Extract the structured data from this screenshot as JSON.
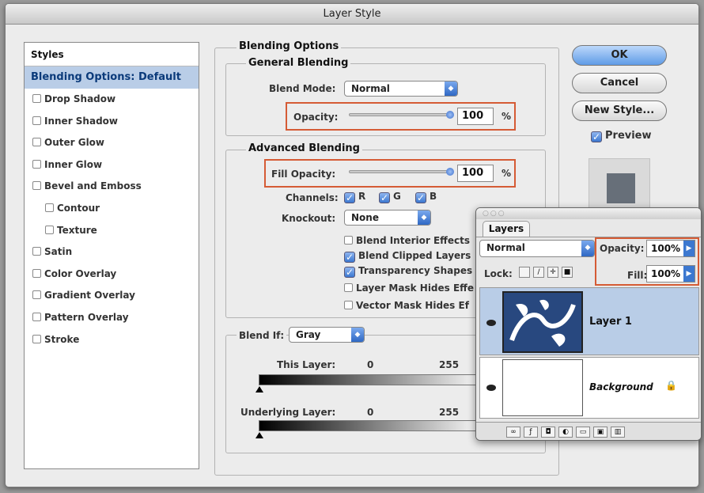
{
  "window": {
    "title": "Layer Style"
  },
  "styles_panel": {
    "header": "Styles",
    "selected": "Blending Options: Default",
    "items": [
      "Drop Shadow",
      "Inner Shadow",
      "Outer Glow",
      "Inner Glow",
      "Bevel and Emboss",
      "Contour",
      "Texture",
      "Satin",
      "Color Overlay",
      "Gradient Overlay",
      "Pattern Overlay",
      "Stroke"
    ]
  },
  "blending": {
    "section_title": "Blending Options",
    "general_title": "General Blending",
    "blend_mode_label": "Blend Mode:",
    "blend_mode_value": "Normal",
    "opacity_label": "Opacity:",
    "opacity_value": "100",
    "opacity_unit": "%",
    "opacity_level": 1.0,
    "advanced_title": "Advanced Blending",
    "fill_opacity_label": "Fill Opacity:",
    "fill_opacity_value": "100",
    "fill_opacity_unit": "%",
    "fill_opacity_level": 1.0,
    "channels_label": "Channels:",
    "channels": [
      "R",
      "G",
      "B"
    ],
    "knockout_label": "Knockout:",
    "knockout_value": "None",
    "options": [
      {
        "label": "Blend Interior Effects",
        "checked": false
      },
      {
        "label": "Blend Clipped Layers",
        "checked": true
      },
      {
        "label": "Transparency Shapes",
        "checked": true
      },
      {
        "label": "Layer Mask Hides Effe",
        "checked": false
      },
      {
        "label": "Vector Mask Hides Ef",
        "checked": false
      }
    ],
    "blend_if_label": "Blend If:",
    "blend_if_value": "Gray",
    "this_layer_label": "This Layer:",
    "this_layer_min": "0",
    "this_layer_max": "255",
    "underlying_label": "Underlying Layer:",
    "underlying_min": "0",
    "underlying_max": "255"
  },
  "buttons": {
    "ok": "OK",
    "cancel": "Cancel",
    "new_style": "New Style...",
    "preview": "Preview"
  },
  "layers_palette": {
    "title_dots": "○○○",
    "tab": "Layers",
    "mode": "Normal",
    "opacity_label": "Opacity:",
    "opacity_value": "100%",
    "fill_label": "Fill:",
    "fill_value": "100%",
    "lock_label": "Lock:",
    "layers": [
      {
        "name": "Layer 1",
        "selected": true
      },
      {
        "name": "Background",
        "selected": false
      }
    ]
  },
  "colors": {
    "accent": "#5f9be6",
    "highlight": "#d55b35",
    "selection": "#b9cde7"
  }
}
